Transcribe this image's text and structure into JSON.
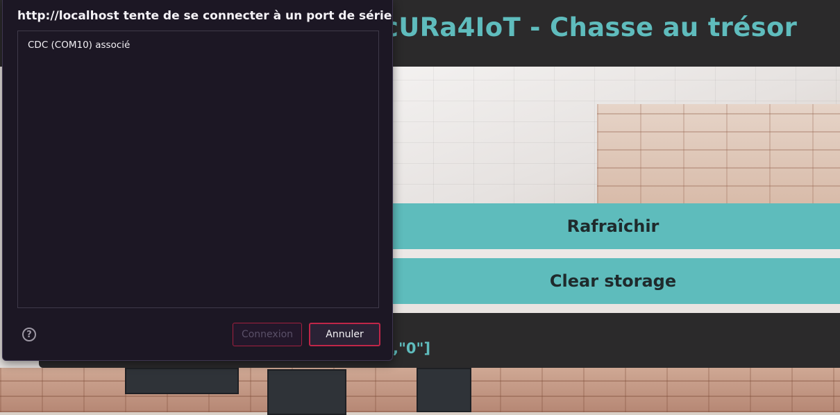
{
  "app": {
    "title": "cURa4IoT - Chasse au trésor",
    "refresh_label": "Rafraîchir",
    "clear_label": "Clear storage",
    "console_output": ",\"0\"]"
  },
  "dialog": {
    "title": "http://localhost tente de se connecter à un port de série",
    "devices": [
      "CDC (COM10) associé"
    ],
    "connect_label": "Connexion",
    "cancel_label": "Annuler",
    "help_glyph": "?"
  },
  "colors": {
    "accent": "#5ebcbc",
    "header_bg": "#2b2a2b",
    "dialog_bg": "#1c1724",
    "button_border": "#c02648"
  },
  "icons": [
    "help-icon"
  ]
}
